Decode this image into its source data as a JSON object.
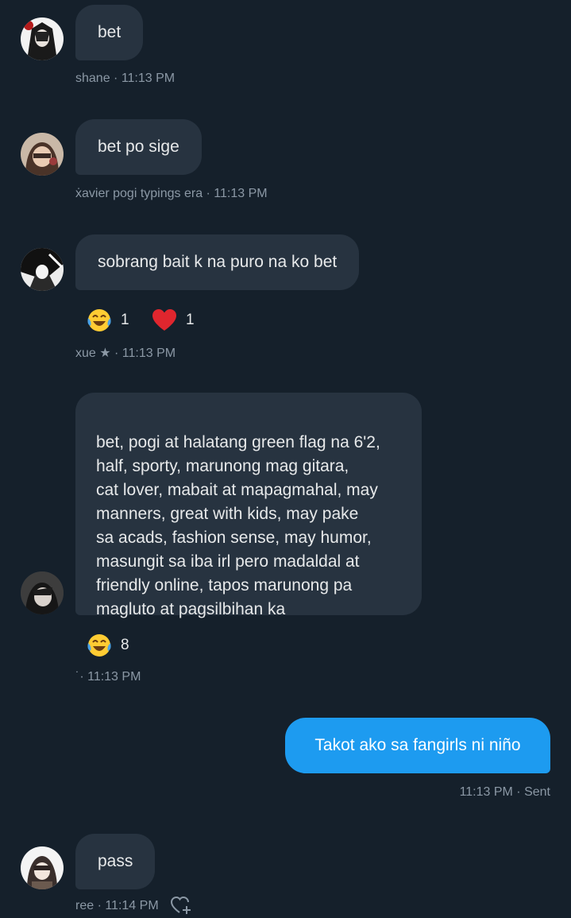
{
  "messages": [
    {
      "sender": "shane",
      "text": "bet",
      "meta": "shane · 11:13 PM"
    },
    {
      "sender": "xavier",
      "text": "bet po sige",
      "meta": "ẋavier pogi typings era · 11:13 PM"
    },
    {
      "sender": "xue",
      "text": "sobrang bait k na puro na ko bet",
      "meta": "xue ★ · 11:13 PM",
      "reactions": [
        {
          "emoji": "face-with-tears-of-joy-icon",
          "count": "1"
        },
        {
          "emoji": "red-heart-icon",
          "count": "1"
        }
      ]
    },
    {
      "sender": "unknown",
      "text": "bet, pogi at halatang green flag na 6'2,\nhalf, sporty, marunong mag gitara,\ncat lover, mabait at mapagmahal, may\nmanners, great with kids, may pake\nsa acads, fashion sense, may humor,\nmasungit sa iba irl pero madaldal at\nfriendly online, tapos marunong pa\nmagluto at pagsilbihan ka",
      "meta": "˙· 11:13 PM",
      "reactions": [
        {
          "emoji": "face-with-tears-of-joy-icon",
          "count": "8"
        }
      ]
    },
    {
      "sender": "me",
      "text": "Takot ako sa fangirls ni niño",
      "meta": "11:13 PM · Sent"
    },
    {
      "sender": "ree",
      "text": "pass",
      "meta": "ree · 11:14 PM"
    }
  ],
  "colors": {
    "background": "#15202b",
    "incoming_bubble": "#273340",
    "outgoing_bubble": "#1d9bf0",
    "meta_text": "#8b98a5"
  }
}
